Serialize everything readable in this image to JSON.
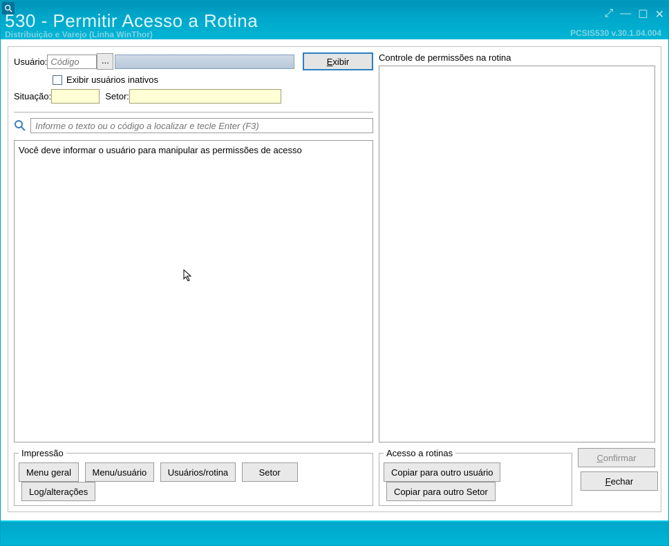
{
  "titlebar": {
    "title": "530 - Permitir Acesso a Rotina",
    "subtitle": "Distribuição e Varejo (Linha WinThor)",
    "version": "PCSIS530   v.30.1.04.004"
  },
  "form": {
    "usuario_label": "Usuário:",
    "codigo_placeholder": "Código",
    "lookup_label": "...",
    "exibir_prefix": "E",
    "exibir_rest": "xibir",
    "inativos_label": "Exibir usuários inativos",
    "situacao_label": "Situação:",
    "setor_label": "Setor:",
    "search_placeholder": "Informe o texto ou o código a localizar e tecle Enter (F3)",
    "main_message": "Você deve informar o usuário para manipular as permissões de acesso"
  },
  "right": {
    "title": "Controle de permissões na rotina"
  },
  "impressao": {
    "legend": "Impressão",
    "menu_geral": "Menu geral",
    "menu_usuario": "Menu/usuário",
    "usuarios_rotina": "Usuários/rotina",
    "setor": "Setor",
    "log": "Log/alterações"
  },
  "acesso": {
    "legend": "Acesso a rotinas",
    "copiar_usuario": "Copiar para outro usuário",
    "copiar_setor": "Copiar para outro Setor"
  },
  "actions": {
    "confirmar_prefix": "C",
    "confirmar_rest": "onfirmar",
    "fechar_prefix": "F",
    "fechar_rest": "echar"
  }
}
